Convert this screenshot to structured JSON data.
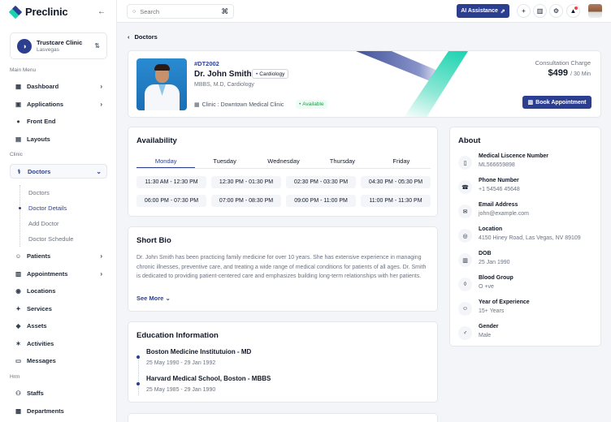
{
  "brand": {
    "name": "Preclinic"
  },
  "clinic": {
    "name": "Trustcare Clinic",
    "location": "Lasvegas"
  },
  "sidebar": {
    "groups": [
      "Main Menu",
      "Clinic",
      "Hrm"
    ],
    "main_items": [
      {
        "label": "Dashboard",
        "icon": "dashboard-icon"
      },
      {
        "label": "Applications",
        "icon": "apps-icon"
      },
      {
        "label": "Front End",
        "icon": "globe-icon"
      },
      {
        "label": "Layouts",
        "icon": "layout-icon"
      }
    ],
    "clinic_items": [
      {
        "label": "Doctors",
        "icon": "doctor-icon"
      },
      {
        "label": "Patients",
        "icon": "patient-icon"
      },
      {
        "label": "Appointments",
        "icon": "calendar-icon"
      },
      {
        "label": "Locations",
        "icon": "location-icon"
      },
      {
        "label": "Services",
        "icon": "services-icon"
      },
      {
        "label": "Assets",
        "icon": "assets-icon"
      },
      {
        "label": "Activities",
        "icon": "activity-icon"
      },
      {
        "label": "Messages",
        "icon": "message-icon"
      }
    ],
    "doctor_sub": [
      "Doctors",
      "Doctor Details",
      "Add Doctor",
      "Doctor Schedule"
    ],
    "hrm_items": [
      {
        "label": "Staffs",
        "icon": "staff-icon"
      },
      {
        "label": "Departments",
        "icon": "department-icon"
      }
    ]
  },
  "topbar": {
    "search_placeholder": "Search",
    "ai_label": "AI Assistance"
  },
  "breadcrumb": {
    "label": "Doctors"
  },
  "doctor": {
    "id": "#DT2002",
    "name": "Dr. John Smith",
    "specialty": "Cardiology",
    "degree": "MBBS, M.D, Cardiology",
    "clinic": "Clinic : Downtown Medical Clinic",
    "status": "Available",
    "charge_label": "Consultation Charge",
    "charge_value": "$499",
    "charge_unit": "/ 30 Min",
    "book_label": "Book Appointment"
  },
  "availability": {
    "title": "Availability",
    "days": [
      "Monday",
      "Tuesday",
      "Wednesday",
      "Thursday",
      "Friday"
    ],
    "active_day": "Monday",
    "slots": [
      "11:30 AM - 12:30 PM",
      "12:30 PM - 01:30 PM",
      "02:30 PM - 03:30 PM",
      "04:30 PM - 05:30 PM",
      "06:00 PM - 07:30 PM",
      "07:00 PM - 08:30 PM",
      "09:00 PM - 11:00 PM",
      "11:00 PM - 11:30 PM"
    ]
  },
  "bio": {
    "title": "Short Bio",
    "text": "Dr. John Smith has been practicing family medicine for over 10 years. She has extensive experience in managing chronic illnesses, preventive care, and treating a wide range of medical conditions for patients of all ages. Dr. Smith is dedicated to providing patient-centered care and emphasizes building long-term relationships with her patients.",
    "see_more": "See More"
  },
  "education": {
    "title": "Education Information",
    "items": [
      {
        "school": "Boston Medicine Institutuion - MD",
        "dates": "25 May 1990 - 29 Jan 1992"
      },
      {
        "school": "Harvard Medical School, Boston - MBBS",
        "dates": "25 May 1985 - 29 Jan 1990"
      }
    ]
  },
  "about": {
    "title": "About",
    "items": [
      {
        "label": "Medical Liscence Number",
        "value": "ML566659898",
        "icon": "license-icon"
      },
      {
        "label": "Phone Number",
        "value": "+1 54546 45648",
        "icon": "phone-icon"
      },
      {
        "label": "Email Address",
        "value": "john@example.com",
        "icon": "mail-icon"
      },
      {
        "label": "Location",
        "value": "4150 Hiney Road, Las Vegas, NV 89109",
        "icon": "map-pin-icon"
      },
      {
        "label": "DOB",
        "value": "25 Jan 1990",
        "icon": "calendar-icon"
      },
      {
        "label": "Blood Group",
        "value": "O +ve",
        "icon": "blood-drop-icon"
      },
      {
        "label": "Year of Experience",
        "value": "15+ Years",
        "icon": "experience-icon"
      },
      {
        "label": "Gender",
        "value": "Male",
        "icon": "gender-icon"
      }
    ]
  },
  "colors": {
    "primary": "#2c3e8f",
    "teal": "#19d3b0",
    "success": "#16a34a"
  }
}
